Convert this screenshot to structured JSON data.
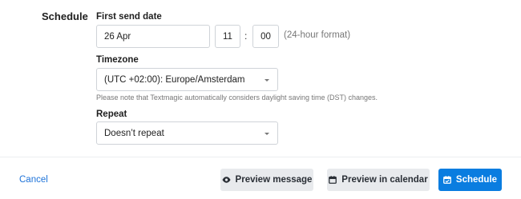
{
  "schedule": {
    "section_label": "Schedule",
    "first_send_date": {
      "label": "First send date",
      "date": "26 Apr",
      "hour": "11",
      "separator": ":",
      "minute": "00",
      "format_hint": "(24-hour format)"
    },
    "timezone": {
      "label": "Timezone",
      "selected": "(UTC +02:00): Europe/Amsterdam",
      "note": "Please note that Textmagic automatically considers daylight saving time (DST) changes."
    },
    "repeat": {
      "label": "Repeat",
      "selected": "Doesn’t repeat"
    }
  },
  "footer": {
    "cancel_label": "Cancel",
    "preview_message_label": "Preview message",
    "preview_message_icon": "eye-icon",
    "preview_calendar_label": "Preview in calendar",
    "preview_calendar_icon": "calendar-icon",
    "schedule_label": "Schedule",
    "schedule_icon": "calendar-check-icon"
  },
  "colors": {
    "primary": "#0a7de0",
    "link": "#1e73d9",
    "secondary_button": "#e8eaed"
  }
}
